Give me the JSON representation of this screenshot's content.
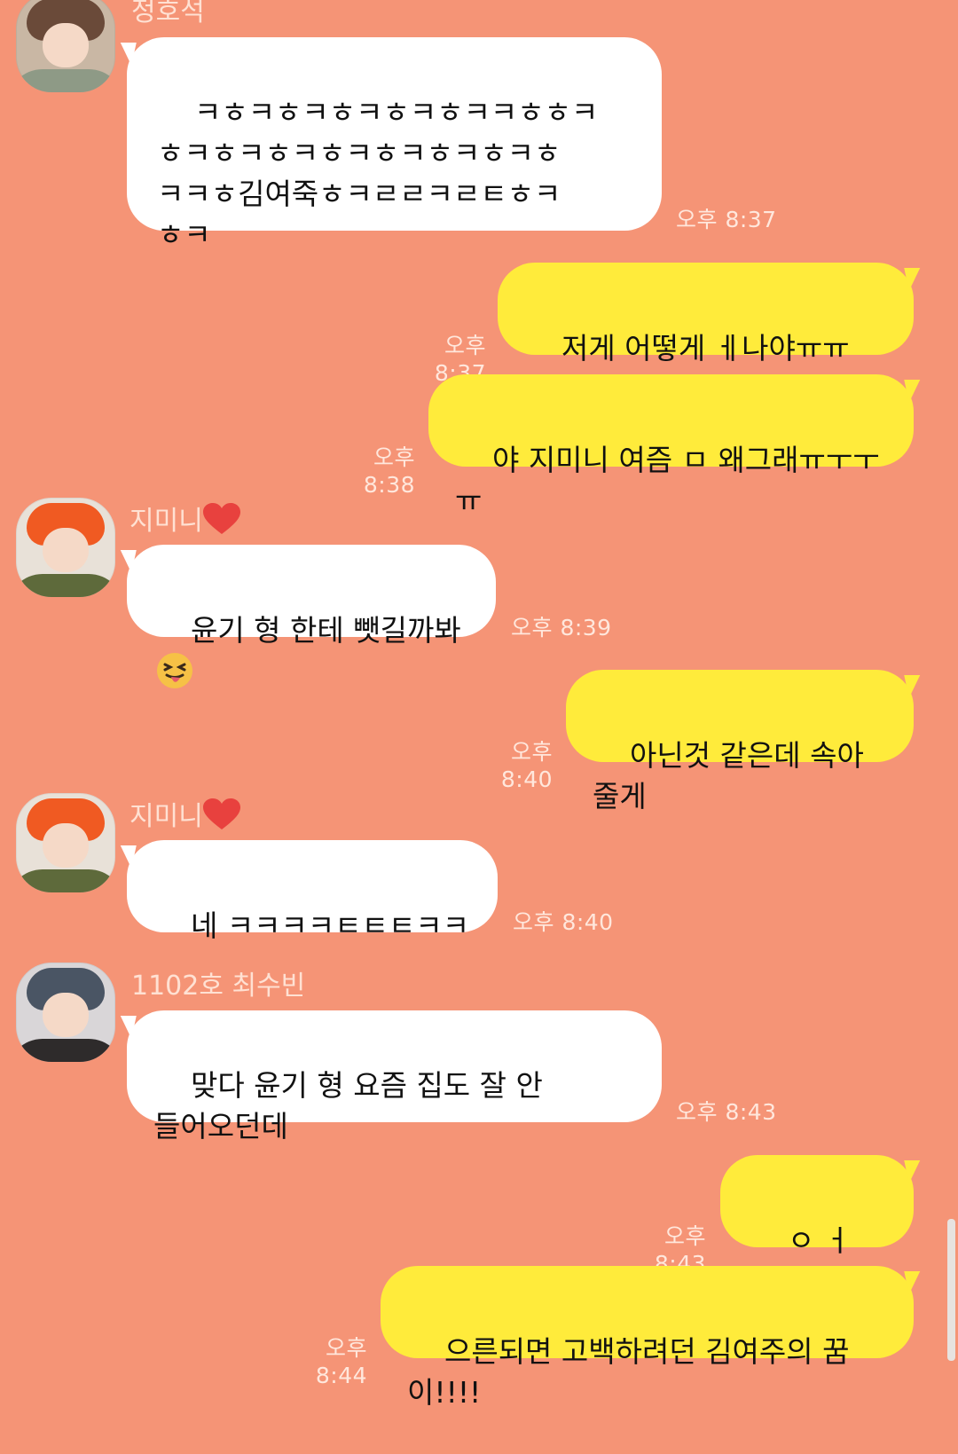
{
  "colors": {
    "background": "#F59476",
    "incoming_bubble": "#FFFFFF",
    "outgoing_bubble": "#FFEB3B",
    "timestamp": "#FFE7DC",
    "sender_name": "#FFE1D3"
  },
  "senders": {
    "hoseok": "정호석",
    "jimin": "지미니",
    "soobin": "1102호 최수빈"
  },
  "messages": [
    {
      "from": "hoseok",
      "text": "ㅋㅎㅋㅎㅋㅎㅋㅎㅋㅎㅋㅋㅎㅎㅋ\nㅎㅋㅎㅋㅎㅋㅎㅋㅎㅋㅎㅋㅎㅋㅎ\nㅋㅋㅎ김여죽ㅎㅋㄹㄹㅋㄹㅌㅎㅋ\nㅎㅋ",
      "time": "오후 8:37"
    },
    {
      "from": "me",
      "text": "저게 어떻게 ㅔ나야ㅠㅠㅡ??",
      "time": "오후 8:37"
    },
    {
      "from": "me",
      "text": "야 지미니 여즘 ㅁ 왜그래ㅠㅜㅜㅠ",
      "time": "오후 8:38"
    },
    {
      "from": "jimin",
      "text": "윤기 형 한테 뺏길까봐",
      "emoji": "tongue-out-emoji",
      "time": "오후 8:39"
    },
    {
      "from": "me",
      "text": "아닌것 같은데 속아줄게",
      "time": "오후 8:40"
    },
    {
      "from": "jimin",
      "text": "네 ㅋㅋㅋㅋㅌㅌㅌㅋㅋ",
      "time": "오후 8:40"
    },
    {
      "from": "soobin",
      "text": "맞다 윤기 형 요즘 집도 잘 안\n들어오던데",
      "time": "오후 8:43"
    },
    {
      "from": "me",
      "text": "ㅇ ㅓ ....?",
      "time": "오후 8:43"
    },
    {
      "from": "me",
      "text": "으른되면 고백하려던 김여주의 꿈이!!!!",
      "time": "오후 8:44"
    }
  ]
}
